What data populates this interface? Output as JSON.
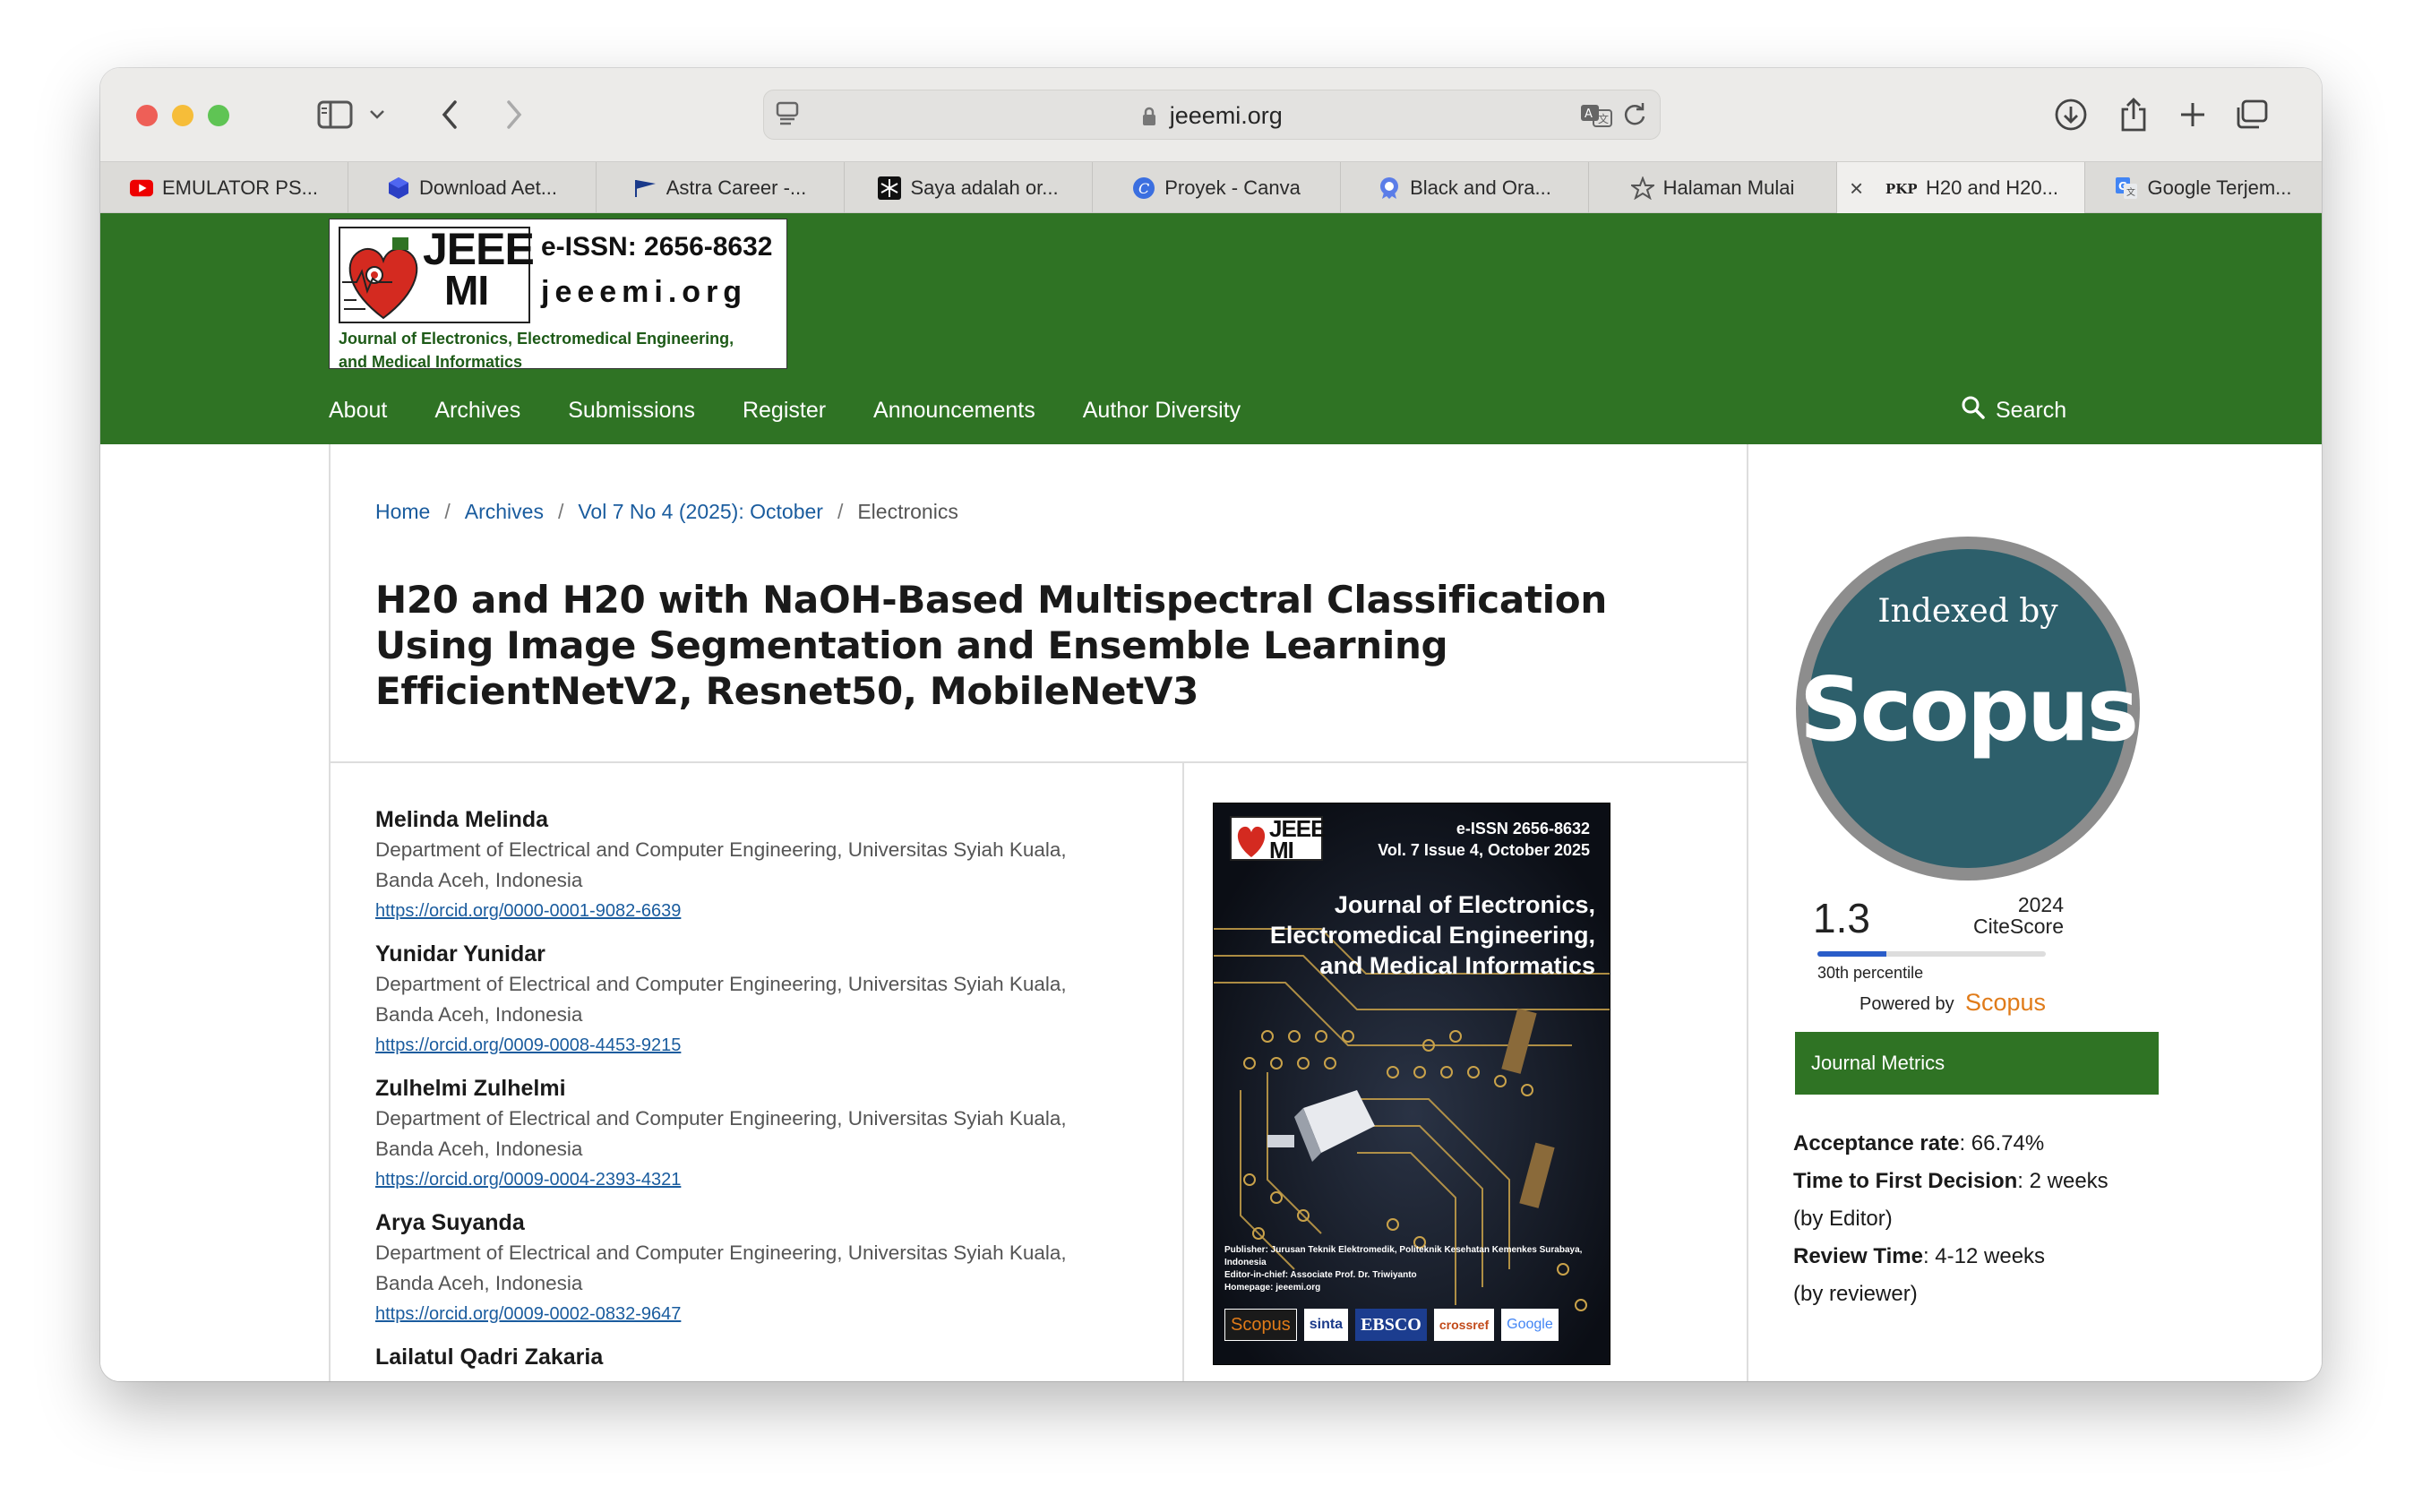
{
  "browser": {
    "url": "jeeemi.org",
    "tabs": [
      {
        "label": "EMULATOR PS...",
        "icon": "youtube-icon"
      },
      {
        "label": "Download Aet...",
        "icon": "cube-icon"
      },
      {
        "label": "Astra Career -...",
        "icon": "flag-icon"
      },
      {
        "label": "Saya adalah or...",
        "icon": "snowflake-icon"
      },
      {
        "label": "Proyek - Canva",
        "icon": "canva-icon"
      },
      {
        "label": "Black and Ora...",
        "icon": "badge-icon"
      },
      {
        "label": "Halaman Mulai",
        "icon": "star-icon"
      },
      {
        "label": "H20 and H20...",
        "icon": "pkp-icon",
        "active": true
      },
      {
        "label": "Google Terjem...",
        "icon": "google-translate-icon"
      }
    ]
  },
  "logo": {
    "jeee": "JEEE",
    "mi": "MI",
    "issn": "e-ISSN: 2656-8632",
    "domain": "jeeemi.org",
    "subtitle_line1": "Journal of Electronics, Electromedical Engineering,",
    "subtitle_line2": "and Medical Informatics"
  },
  "nav": {
    "items": [
      "About",
      "Archives",
      "Submissions",
      "Register",
      "Announcements",
      "Author Diversity"
    ],
    "search": "Search"
  },
  "breadcrumb": {
    "home": "Home",
    "archives": "Archives",
    "issue": "Vol 7 No 4 (2025): October",
    "section": "Electronics"
  },
  "article": {
    "title": "H20 and H20 with NaOH-Based Multispectral Classification Using Image Segmentation and Ensemble Learning EfficientNetV2, Resnet50, MobileNetV3"
  },
  "authors": [
    {
      "name": "Melinda Melinda",
      "aff1": "Department of Electrical and Computer Engineering, Universitas Syiah Kuala,",
      "aff2": "Banda Aceh, Indonesia",
      "orcid": "https://orcid.org/0000-0001-9082-6639"
    },
    {
      "name": "Yunidar Yunidar",
      "aff1": "Department of Electrical and Computer Engineering, Universitas Syiah Kuala,",
      "aff2": "Banda Aceh, Indonesia",
      "orcid": "https://orcid.org/0009-0008-4453-9215"
    },
    {
      "name": "Zulhelmi Zulhelmi",
      "aff1": "Department of Electrical and Computer Engineering, Universitas Syiah Kuala,",
      "aff2": "Banda Aceh, Indonesia",
      "orcid": "https://orcid.org/0009-0004-2393-4321"
    },
    {
      "name": "Arya Suyanda",
      "aff1": "Department of Electrical and Computer Engineering, Universitas Syiah Kuala,",
      "aff2": "Banda Aceh, Indonesia",
      "orcid": "https://orcid.org/0009-0002-0832-9647"
    },
    {
      "name": "Lailatul Qadri Zakaria",
      "aff1": "",
      "aff2": "",
      "orcid": ""
    }
  ],
  "cover": {
    "logo": "JEEE MI",
    "issn": "e-ISSN  2656-8632",
    "volume": "Vol. 7 Issue 4, October 2025",
    "title_line1": "Journal of Electronics,",
    "title_line2": "Electromedical Engineering,",
    "title_line3": "and Medical Informatics",
    "publisher": "Publisher: Jurusan Teknik Elektromedik, Politeknik Kesehatan Kemenkes Surabaya, Indonesia",
    "editor": "Editor-in-chief: Associate Prof. Dr. Triwiyanto",
    "homepage": "Homepage: jeeemi.org",
    "badges": [
      "Scopus",
      "sinta",
      "EBSCO",
      "crossref",
      "Google"
    ]
  },
  "sidebar": {
    "indexed_by": "Indexed by",
    "scopus": "Scopus",
    "citescore": "1.3",
    "citescore_year": "2024",
    "citescore_label": "CiteScore",
    "percentile": 30,
    "percentile_label": "30th percentile",
    "powered_by": "Powered by",
    "powered_brand": "Scopus",
    "metrics_button": "Journal Metrics",
    "acceptance_label": "Acceptance rate",
    "acceptance_value": ": 66.74%",
    "first_decision_label": "Time to First Decision",
    "first_decision_value": ": 2 weeks",
    "first_decision_note": "(by Editor)",
    "review_label": "Review Time",
    "review_value": ": 4-12 weeks",
    "review_note": "(by reviewer)"
  },
  "colors": {
    "brand_green": "#2f7324",
    "scopus_teal": "#2d5f6b",
    "link_blue": "#1a5c9e",
    "scopus_orange": "#e07b19"
  }
}
